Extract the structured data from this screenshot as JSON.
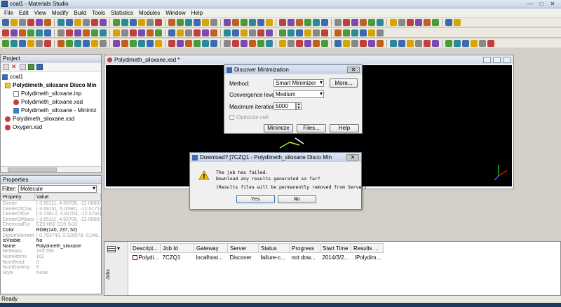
{
  "window": {
    "title": "coal1 - Materials Studio"
  },
  "menu": [
    "File",
    "Edit",
    "View",
    "Modify",
    "Build",
    "Tools",
    "Statistics",
    "Modules",
    "Window",
    "Help"
  ],
  "project": {
    "header": "Project",
    "items": [
      {
        "label": "coal1",
        "icon": "project-icon"
      },
      {
        "label": "Polydimeth_siloxane Disco Min",
        "icon": "folder-icon"
      },
      {
        "label": "Polydimeth_siloxane.inp",
        "icon": "file-icon"
      },
      {
        "label": "Polydimeth_siloxane.xsd",
        "icon": "molecule-icon"
      },
      {
        "label": "Polydimeth_siloxane - Minimiz",
        "icon": "chart-icon"
      },
      {
        "label": "Polydimeth_siloxane.xsd",
        "icon": "molecule-icon"
      },
      {
        "label": "Oxygen.xsd",
        "icon": "molecule-icon"
      }
    ]
  },
  "properties": {
    "header": "Properties",
    "filter_label": "Filter:",
    "filter_value": "Molecule",
    "col_property": "Property",
    "col_value": "Value",
    "rows": [
      {
        "name": "Center",
        "value": "(-3.65111, 4.93708, -12.0860)",
        "dim": true
      },
      {
        "name": "CenterOfCha",
        "value": "(-3.69151, 5.00961, -12.0171)",
        "dim": true
      },
      {
        "name": "CenterOfGe",
        "value": "(-3.73812, 4.91753, -12.0702)",
        "dim": true
      },
      {
        "name": "CenterOfMass",
        "value": "(-3.65111, 4.93708, -12.0860)",
        "dim": true
      },
      {
        "name": "ChemicalFor",
        "value": "C20 H62 O10 Si10",
        "dim": true
      },
      {
        "name": "Color",
        "value": "RGB(140, 237, 52)",
        "dim": false
      },
      {
        "name": "DipoleMoment",
        "value": "(-0.793743, 0.520578, 0.048...",
        "dim": true
      },
      {
        "name": "IsVisible",
        "value": "No",
        "dim": false
      },
      {
        "name": "Name",
        "value": "Polydimeth_siloxane",
        "dim": false
      },
      {
        "name": "NetMass",
        "value": "743.556",
        "dim": true
      },
      {
        "name": "NumAtoms",
        "value": "102",
        "dim": true
      },
      {
        "name": "NumBead",
        "value": "0",
        "dim": true
      },
      {
        "name": "NumDummy",
        "value": "0",
        "dim": true
      },
      {
        "name": "Style",
        "value": "None",
        "dim": true
      }
    ]
  },
  "document": {
    "title": "Polydimeth_siloxane.xsd *"
  },
  "discover_dialog": {
    "title": "Discover Minimization",
    "method_label": "Method:",
    "method_value": "Smart Minimizer",
    "more_button": "More...",
    "convergence_label": "Convergence level:",
    "convergence_value": "Medium",
    "max_iter_label": "Maximum iterations:",
    "max_iter_value": "5000",
    "optimize_cell_label": "Optimize cell",
    "minimize_button": "Minimize",
    "files_button": "Files...",
    "help_button": "Help"
  },
  "download_dialog": {
    "title": "Download? [7CZQ1 - Polydimeth_siloxane Disco Min",
    "line1": "The job has failed.",
    "line2": "Download any results generated so far?",
    "line3": "(Results files will be permanently removed from Server)",
    "yes_button": "Yes",
    "no_button": "No"
  },
  "jobs": {
    "side_label": "Jobs",
    "columns": [
      "Descript...",
      "Job Id",
      "Gateway",
      "Server",
      "Status",
      "Progress",
      "Start Time",
      "Results ..."
    ],
    "rows": [
      [
        "Polydi...",
        "7CZQ1",
        "localhost...",
        "Discover",
        "failure-c...",
        "not dow...",
        "2014/3/2...",
        ".\\Polydim..."
      ]
    ]
  },
  "status": {
    "text": "Ready"
  },
  "colors": {
    "canvas_bg": "#000000",
    "axis_x": "#e01010",
    "axis_y": "#10c010",
    "axis_z": "#3060ff",
    "warning": "#f2c200"
  }
}
